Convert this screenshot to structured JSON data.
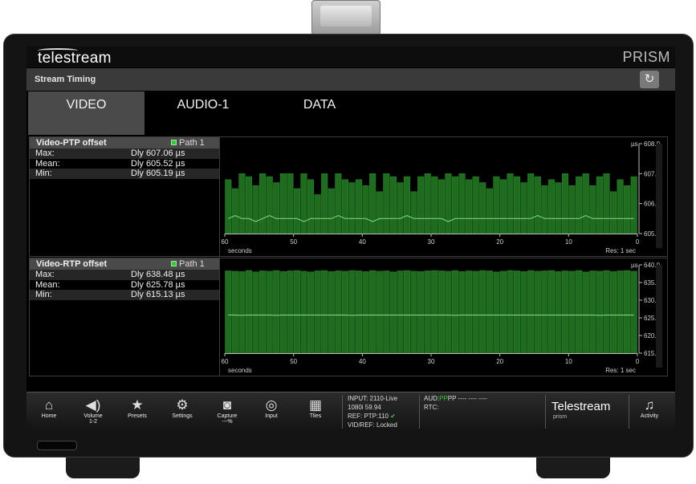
{
  "device": {
    "logo": "telestream",
    "model": "PRISM"
  },
  "header": {
    "title": "Stream Timing",
    "reset_icon": "reset-icon"
  },
  "tabs": [
    {
      "label": "VIDEO",
      "active": true
    },
    {
      "label": "AUDIO-1",
      "active": false
    },
    {
      "label": "DATA",
      "active": false
    }
  ],
  "colors": {
    "bar_fill": "#1f6b1f",
    "bar_stroke": "#2f8f2f",
    "trace": "#7ee07e",
    "path_indicator": "#3cc63c"
  },
  "panels": [
    {
      "title": "Video-PTP offset",
      "path": "Path 1",
      "rows": [
        {
          "label": "Max:",
          "value": "Dly 607.06 µs"
        },
        {
          "label": "Mean:",
          "value": "Dly 605.52 µs"
        },
        {
          "label": "Min:",
          "value": "Dly 605.19 µs"
        }
      ],
      "unit": "µs",
      "y_ticks": [
        "608.0",
        "607.0",
        "606.0",
        "605.0"
      ],
      "x_ticks": [
        "60",
        "50",
        "40",
        "30",
        "20",
        "10",
        "0"
      ],
      "x_caption": "seconds",
      "resolution": "Res: 1 sec"
    },
    {
      "title": "Video-RTP offset",
      "path": "Path 1",
      "rows": [
        {
          "label": "Max:",
          "value": "Dly 638.48 µs"
        },
        {
          "label": "Mean:",
          "value": "Dly 625.78 µs"
        },
        {
          "label": "Min:",
          "value": "Dly 615.13 µs"
        }
      ],
      "unit": "µs",
      "y_ticks": [
        "640.0",
        "635.0",
        "630.0",
        "625.0",
        "620.0",
        "615.0"
      ],
      "x_ticks": [
        "60",
        "50",
        "40",
        "30",
        "20",
        "10",
        "0"
      ],
      "x_caption": "seconds",
      "resolution": "Res: 1 sec"
    }
  ],
  "chart_data": [
    {
      "type": "bar",
      "title": "Video-PTP offset",
      "xlabel": "seconds",
      "ylabel": "µs",
      "xlim": [
        60,
        0
      ],
      "ylim": [
        605.0,
        608.0
      ],
      "series": [
        {
          "name": "Max",
          "values": [
            606.8,
            606.5,
            607.0,
            606.9,
            606.6,
            607.0,
            606.9,
            606.7,
            607.0,
            607.0,
            606.5,
            607.0,
            606.8,
            606.3,
            607.0,
            606.5,
            607.0,
            606.8,
            606.7,
            606.8,
            606.6,
            607.0,
            606.4,
            607.0,
            606.9,
            606.7,
            606.9,
            606.4,
            606.9,
            607.0,
            606.9,
            606.8,
            607.0,
            606.9,
            607.0,
            606.8,
            606.9,
            606.7,
            606.5,
            606.9,
            606.8,
            607.0,
            606.9,
            606.7,
            607.0,
            606.9,
            606.6,
            606.8,
            606.7,
            607.0,
            606.6,
            606.9,
            607.0,
            606.6,
            606.9,
            607.0,
            606.4,
            606.8,
            606.6,
            606.9
          ]
        },
        {
          "name": "Mean",
          "values": [
            605.5,
            605.6,
            605.5,
            605.5,
            605.4,
            605.5,
            605.6,
            605.5,
            605.5,
            605.5,
            605.5,
            605.4,
            605.5,
            605.5,
            605.5,
            605.5,
            605.6,
            605.5,
            605.5,
            605.5,
            605.5,
            605.4,
            605.5,
            605.5,
            605.5,
            605.5,
            605.6,
            605.5,
            605.5,
            605.5,
            605.5,
            605.5,
            605.4,
            605.5,
            605.5,
            605.5,
            605.5,
            605.5,
            605.5,
            605.5,
            605.5,
            605.5,
            605.5,
            605.5,
            605.5,
            605.6,
            605.5,
            605.5,
            605.5,
            605.5,
            605.5,
            605.5,
            605.6,
            605.5,
            605.5,
            605.5,
            605.5,
            605.5,
            605.5,
            605.5
          ]
        }
      ]
    },
    {
      "type": "bar",
      "title": "Video-RTP offset",
      "xlabel": "seconds",
      "ylabel": "µs",
      "xlim": [
        60,
        0
      ],
      "ylim": [
        615.0,
        640.0
      ],
      "series": [
        {
          "name": "Max",
          "values": [
            638.3,
            638.2,
            638.1,
            638.4,
            638.0,
            638.3,
            638.2,
            638.4,
            638.1,
            638.3,
            638.4,
            638.2,
            638.0,
            638.3,
            638.4,
            638.1,
            638.3,
            638.2,
            638.4,
            638.3,
            638.1,
            638.4,
            638.2,
            638.3,
            638.0,
            638.3,
            638.4,
            638.2,
            638.1,
            638.3,
            638.4,
            638.3,
            638.2,
            638.4,
            638.1,
            638.3,
            638.2,
            638.4,
            638.3,
            638.0,
            638.2,
            638.4,
            638.3,
            638.1,
            638.4,
            638.2,
            638.3,
            638.4,
            638.1,
            638.3,
            638.2,
            638.4,
            638.0,
            638.3,
            638.2,
            638.4,
            638.1,
            638.3,
            638.4,
            638.2
          ]
        },
        {
          "name": "Mean",
          "values": [
            625.8,
            625.8,
            625.7,
            625.8,
            625.8,
            625.8,
            625.8,
            625.7,
            625.8,
            625.8,
            625.8,
            625.8,
            625.8,
            625.8,
            625.8,
            625.8,
            625.8,
            625.8,
            625.7,
            625.8,
            625.8,
            625.8,
            625.8,
            625.8,
            625.8,
            625.8,
            625.8,
            625.8,
            625.8,
            625.8,
            625.8,
            625.8,
            625.8,
            625.7,
            625.8,
            625.8,
            625.8,
            625.8,
            625.8,
            625.8,
            625.8,
            625.8,
            625.8,
            625.8,
            625.8,
            625.8,
            625.8,
            625.8,
            625.8,
            625.8,
            625.8,
            625.8,
            625.8,
            625.8,
            625.7,
            625.8,
            625.8,
            625.8,
            625.8,
            625.8
          ]
        }
      ]
    }
  ],
  "bottom_nav": [
    {
      "label": "Home",
      "sub": "",
      "icon": "home-icon",
      "glyph": "⌂"
    },
    {
      "label": "Volume",
      "sub": "1-2",
      "icon": "speaker-icon",
      "glyph": "🔊"
    },
    {
      "label": "Presets",
      "sub": "",
      "icon": "star-icon",
      "glyph": "★"
    },
    {
      "label": "Settings",
      "sub": "",
      "icon": "gear-icon",
      "glyph": "⚙"
    },
    {
      "label": "Capture",
      "sub": "---%",
      "icon": "camera-icon",
      "glyph": "◙"
    },
    {
      "label": "Input",
      "sub": "",
      "icon": "input-icon",
      "glyph": "◎"
    },
    {
      "label": "Tiles",
      "sub": "",
      "icon": "tiles-icon",
      "glyph": "▦"
    }
  ],
  "status": {
    "input": "INPUT: 2110-Live",
    "format": "1080i 59.94",
    "ref": "REF: PTP:110",
    "vidref": "VID/REF: Locked",
    "aud_label": "AUD:",
    "aud_pp": "PP",
    "aud_rest": "PP ---- ---- ----",
    "rtc": "RTC:"
  },
  "brand": {
    "name": "Telestream",
    "sub": "prism"
  },
  "activity": {
    "label": "Activity",
    "icon": "bell-icon",
    "glyph": "🔔"
  }
}
